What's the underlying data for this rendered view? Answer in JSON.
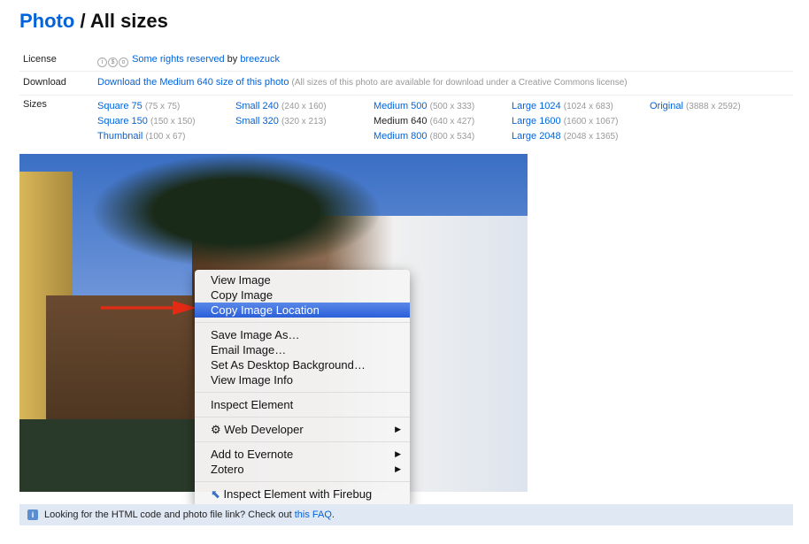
{
  "title": {
    "link": "Photo",
    "rest": " / All sizes"
  },
  "license": {
    "label": "License",
    "rights": "Some rights reserved",
    "by": " by ",
    "author": "breezuck"
  },
  "download": {
    "label": "Download",
    "link": "Download the Medium 640 size of this photo",
    "note": "(All sizes of this photo are available for download under a Creative Commons license)"
  },
  "sizes": {
    "label": "Sizes",
    "columns": [
      [
        {
          "name": "Square 75",
          "dim": "(75 x 75)",
          "current": false
        },
        {
          "name": "Square 150",
          "dim": "(150 x 150)",
          "current": false
        },
        {
          "name": "Thumbnail",
          "dim": "(100 x 67)",
          "current": false
        }
      ],
      [
        {
          "name": "Small 240",
          "dim": "(240 x 160)",
          "current": false
        },
        {
          "name": "Small 320",
          "dim": "(320 x 213)",
          "current": false
        }
      ],
      [
        {
          "name": "Medium 500",
          "dim": "(500 x 333)",
          "current": false
        },
        {
          "name": "Medium 640",
          "dim": "(640 x 427)",
          "current": true
        },
        {
          "name": "Medium 800",
          "dim": "(800 x 534)",
          "current": false
        }
      ],
      [
        {
          "name": "Large 1024",
          "dim": "(1024 x 683)",
          "current": false
        },
        {
          "name": "Large 1600",
          "dim": "(1600 x 1067)",
          "current": false
        },
        {
          "name": "Large 2048",
          "dim": "(2048 x 1365)",
          "current": false
        }
      ],
      [
        {
          "name": "Original",
          "dim": "(3888 x 2592)",
          "current": false
        }
      ]
    ]
  },
  "menu": {
    "items": [
      "View Image",
      "Copy Image",
      "Copy Image Location",
      "Save Image As…",
      "Email Image…",
      "Set As Desktop Background…",
      "View Image Info",
      "Inspect Element",
      "Web Developer",
      "Add to Evernote",
      "Zotero",
      "Inspect Element with Firebug"
    ],
    "highlighted": "Copy Image Location"
  },
  "info": {
    "text": "Looking for the HTML code and photo file link? Check out ",
    "link": "this FAQ",
    "end": "."
  }
}
